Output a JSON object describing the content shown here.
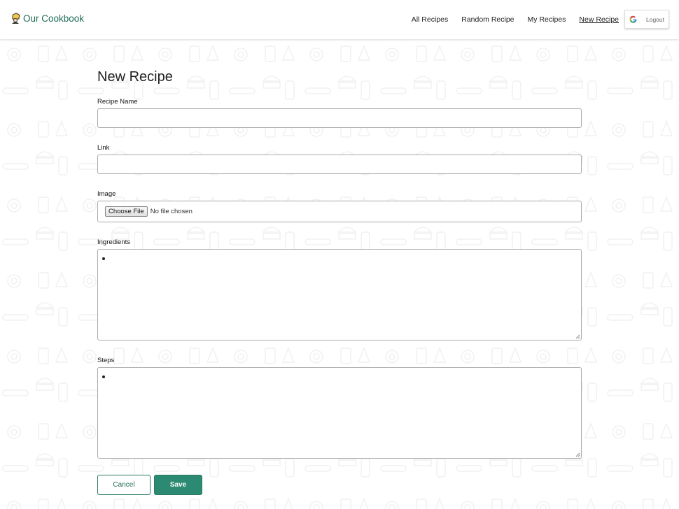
{
  "brand": {
    "name": "Our Cookbook",
    "icon": "chef-icon"
  },
  "nav": {
    "items": [
      {
        "label": "All Recipes",
        "active": false
      },
      {
        "label": "Random Recipe",
        "active": false
      },
      {
        "label": "My Recipes",
        "active": false
      },
      {
        "label": "New Recipe",
        "active": true
      }
    ],
    "logout_label": "Logout",
    "logout_icon": "google-icon"
  },
  "form": {
    "title": "New Recipe",
    "recipe_name": {
      "label": "Recipe Name",
      "value": ""
    },
    "link": {
      "label": "Link",
      "value": ""
    },
    "image": {
      "label": "Image",
      "button_label": "Choose File",
      "status": "No file chosen"
    },
    "ingredients": {
      "label": "Ingredients",
      "items": [
        ""
      ]
    },
    "steps": {
      "label": "Steps",
      "items": [
        ""
      ]
    },
    "cancel_label": "Cancel",
    "save_label": "Save"
  },
  "colors": {
    "accent": "#2d8a72",
    "brand_text": "#1f6b55"
  }
}
